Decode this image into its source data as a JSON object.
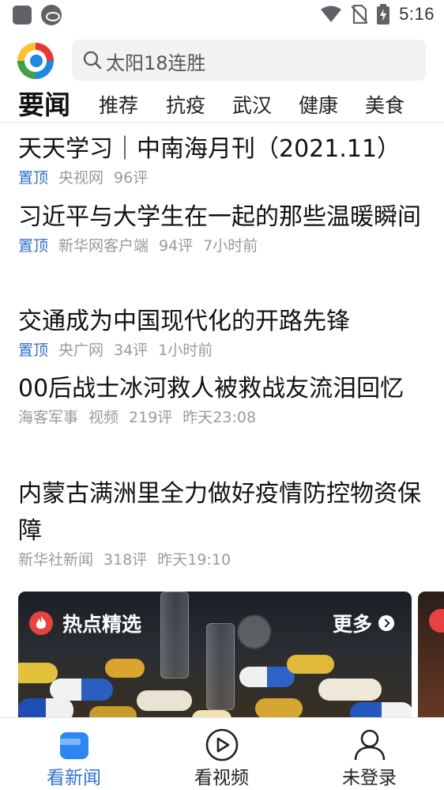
{
  "status_bar": {
    "time": "5:16",
    "icons": [
      "app-square-icon",
      "sync-icon",
      "wifi-icon",
      "no-sim-icon",
      "battery-charging-icon"
    ]
  },
  "header": {
    "logo": "news-app-logo",
    "search": {
      "placeholder": "太阳18连胜"
    }
  },
  "tabs": [
    {
      "label": "要闻",
      "active": true
    },
    {
      "label": "推荐"
    },
    {
      "label": "抗疫"
    },
    {
      "label": "武汉"
    },
    {
      "label": "健康"
    },
    {
      "label": "美食"
    }
  ],
  "news": [
    {
      "title": "天天学习｜中南海月刊（2021.11）",
      "tag": "置顶",
      "source": "央视网",
      "comments": "96评",
      "time": ""
    },
    {
      "title": "习近平与大学生在一起的那些温暖瞬间",
      "tag": "置顶",
      "source": "新华网客户端",
      "comments": "94评",
      "time": "7小时前"
    },
    {
      "title": "交通成为中国现代化的开路先锋",
      "tag": "置顶",
      "source": "央广网",
      "comments": "34评",
      "time": "1小时前"
    },
    {
      "title": "00后战士冰河救人被救战友流泪回忆",
      "tag": "",
      "source": "海客军事",
      "type": "视频",
      "comments": "219评",
      "time": "昨天23:08"
    },
    {
      "title": "内蒙古满洲里全力做好疫情防控物资保障",
      "tag": "",
      "source": "新华社新闻",
      "comments": "318评",
      "time": "昨天19:10"
    }
  ],
  "hot_card": {
    "title": "热点精选",
    "more": "更多"
  },
  "bottom_nav": [
    {
      "label": "看新闻",
      "icon": "news-icon",
      "active": true
    },
    {
      "label": "看视频",
      "icon": "play-circle-icon"
    },
    {
      "label": "未登录",
      "icon": "user-icon"
    }
  ],
  "colors": {
    "accent": "#2e72d2",
    "pin_tag": "#2f6fc9",
    "meta_gray": "#9a9a9a",
    "fire_red": "#e84141"
  }
}
